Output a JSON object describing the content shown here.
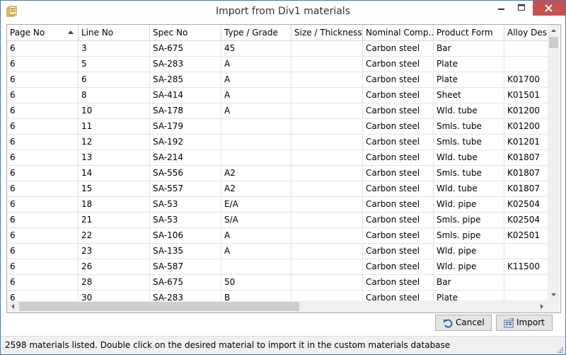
{
  "window": {
    "title": "Import from Div1 materials"
  },
  "grid": {
    "columns": [
      "Page No",
      "Line No",
      "Spec No",
      "Type / Grade",
      "Size / Thickness",
      "Nominal Comp...",
      "Product Form",
      "Alloy Desi"
    ],
    "sorted_column": "Page No",
    "sort_direction": "ascending",
    "rows": [
      [
        "6",
        "3",
        "SA-675",
        "45",
        "",
        "Carbon steel",
        "Bar",
        ""
      ],
      [
        "6",
        "5",
        "SA-283",
        "A",
        "",
        "Carbon steel",
        "Plate",
        ""
      ],
      [
        "6",
        "6",
        "SA-285",
        "A",
        "",
        "Carbon steel",
        "Plate",
        "K01700"
      ],
      [
        "6",
        "8",
        "SA-414",
        "A",
        "",
        "Carbon steel",
        "Sheet",
        "K01501"
      ],
      [
        "6",
        "10",
        "SA-178",
        "A",
        "",
        "Carbon steel",
        "Wld. tube",
        "K01200"
      ],
      [
        "6",
        "11",
        "SA-179",
        "",
        "",
        "Carbon steel",
        "Smls. tube",
        "K01200"
      ],
      [
        "6",
        "12",
        "SA-192",
        "",
        "",
        "Carbon steel",
        "Smls. tube",
        "K01201"
      ],
      [
        "6",
        "13",
        "SA-214",
        "",
        "",
        "Carbon steel",
        "Wld. tube",
        "K01807"
      ],
      [
        "6",
        "14",
        "SA-556",
        "A2",
        "",
        "Carbon steel",
        "Smls. tube",
        "K01807"
      ],
      [
        "6",
        "15",
        "SA-557",
        "A2",
        "",
        "Carbon steel",
        "Wld. tube",
        "K01807"
      ],
      [
        "6",
        "18",
        "SA-53",
        "E/A",
        "",
        "Carbon steel",
        "Wld. pipe",
        "K02504"
      ],
      [
        "6",
        "21",
        "SA-53",
        "S/A",
        "",
        "Carbon steel",
        "Smls. pipe",
        "K02504"
      ],
      [
        "6",
        "22",
        "SA-106",
        "A",
        "",
        "Carbon steel",
        "Smls. pipe",
        "K02501"
      ],
      [
        "6",
        "23",
        "SA-135",
        "A",
        "",
        "Carbon steel",
        "Wld. pipe",
        ""
      ],
      [
        "6",
        "26",
        "SA-587",
        "",
        "",
        "Carbon steel",
        "Wld. pipe",
        "K11500"
      ],
      [
        "6",
        "28",
        "SA-675",
        "50",
        "",
        "Carbon steel",
        "Bar",
        ""
      ],
      [
        "6",
        "30",
        "SA-283",
        "B",
        "",
        "Carbon steel",
        "Plate",
        ""
      ]
    ]
  },
  "buttons": {
    "cancel_label": "Cancel",
    "import_label": "Import"
  },
  "status": {
    "text": "2598 materials listed. Double click on the desired material to import it in the custom materials database"
  },
  "colors": {
    "close_button": "#c75050",
    "window_border": "#3c7fb1",
    "grid_lines": "#e4e4e4"
  }
}
